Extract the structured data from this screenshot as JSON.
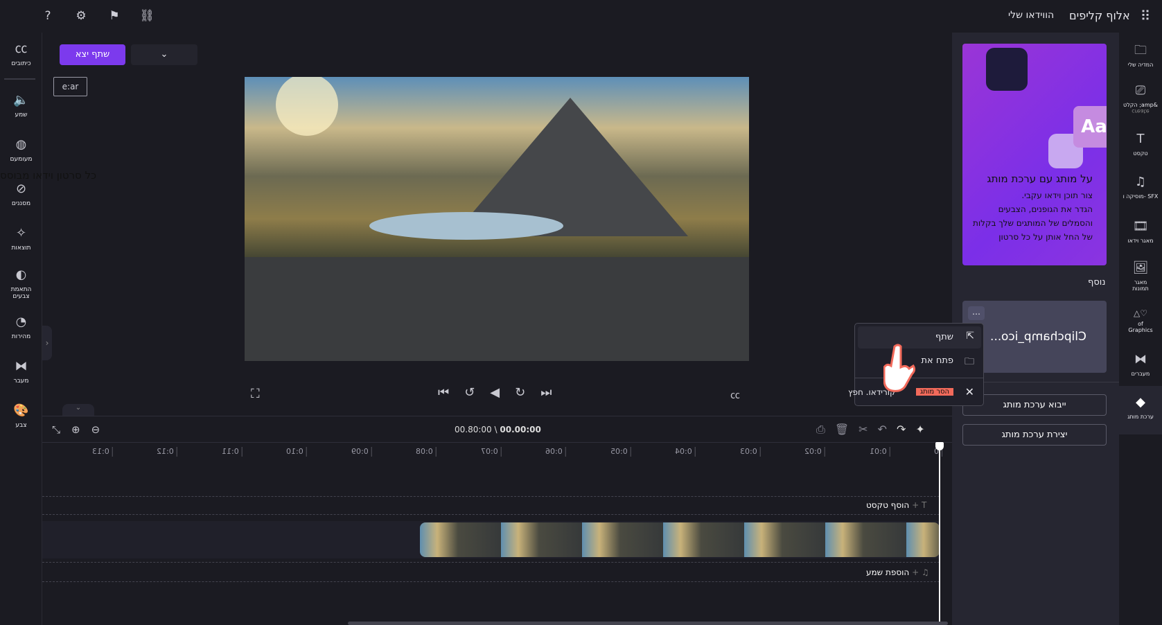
{
  "topbar": {
    "brand": "אלוף קליפים",
    "my_videos": "הווידאו שלי",
    "icons": [
      "apps-grid-icon",
      "help-icon",
      "settings-icon",
      "feedback-flag-icon",
      "share-nodes-icon"
    ]
  },
  "toolbar": {
    "export_label": "שתף יצא",
    "aspect_ratio": "e:ar"
  },
  "stray_text": "כל סרטון וידאו מבוסס",
  "left_sidebar": {
    "items": [
      {
        "label": "כיתובים",
        "icon": "captions-icon"
      },
      {
        "label": "שמע",
        "icon": "audio-icon"
      },
      {
        "label": "מעומעם",
        "icon": "fade-icon"
      },
      {
        "label": "מסננים",
        "icon": "filters-icon"
      },
      {
        "label": "תוצאות",
        "icon": "effects-wand-icon"
      },
      {
        "label": "התאמת צבעים",
        "icon": "color-adjust-icon"
      },
      {
        "label": "מהירות",
        "icon": "speed-icon"
      },
      {
        "label": "מעבר",
        "icon": "transition-icon"
      },
      {
        "label": "צבע",
        "icon": "palette-icon"
      }
    ]
  },
  "right_sidebar": {
    "items": [
      {
        "label": "המדיה שלי",
        "icon": "folder-icon"
      },
      {
        "label": "הקלט ;amp&",
        "sub": "create",
        "icon": "record-icon"
      },
      {
        "label": "טקסט",
        "icon": "text-icon"
      },
      {
        "label": "מוסיקה ו- SFX",
        "icon": "music-icon"
      },
      {
        "label": "מאגר וידאו",
        "icon": "film-icon"
      },
      {
        "label": "מאגר תמונות",
        "icon": "image-icon"
      },
      {
        "label": "of Graphics",
        "icon": "shapes-icon"
      },
      {
        "label": "מעברים",
        "icon": "transition-icon"
      },
      {
        "label": "ערכת מותג",
        "icon": "brand-kit-icon"
      }
    ]
  },
  "brand_panel": {
    "promo_title": "על מותג עם ערכת מותג",
    "promo_lines": [
      "צור תוכן וידאו עקבי.",
      "הגדר את הגופנים, הצבעים",
      "והסמלים של המותגים שלך בקלות",
      "של החל אותן על כל סרטון"
    ],
    "section_label": "נוסף",
    "kit_name": "Clipchamp_ico...",
    "import_button": "ייבוא ערכת מותג",
    "create_button": "יצירת ערכת מותג"
  },
  "context_menu": {
    "items": [
      {
        "label": "שתף",
        "icon": "share-icon"
      },
      {
        "label": "פתח את",
        "icon": "folder-icon"
      },
      {
        "label": "הסר מותג",
        "extra": "קורידאו. חפץ",
        "icon": "close-icon"
      }
    ]
  },
  "player": {
    "controls": [
      "fullscreen-icon",
      "skip-back-icon",
      "rewind-5-icon",
      "play-icon",
      "forward-5-icon",
      "skip-forward-icon",
      "captions-icon"
    ]
  },
  "timeline": {
    "time_current": "00.00:00",
    "time_total": "00.80:00",
    "separator": "\\",
    "ruler": [
      "0",
      "0:01",
      "0:02",
      "0:03",
      "0:04",
      "0:05",
      "0:06",
      "0:07",
      "0:08",
      "0:09",
      "0:10",
      "0:11",
      "0:12",
      "0:13"
    ],
    "add_text": "הוסף טקסט",
    "add_audio": "הוספת שמע"
  },
  "colors": {
    "accent": "#7c3aed",
    "background": "#1b1b22",
    "panel": "#262631",
    "highlight": "#f26a5b"
  }
}
